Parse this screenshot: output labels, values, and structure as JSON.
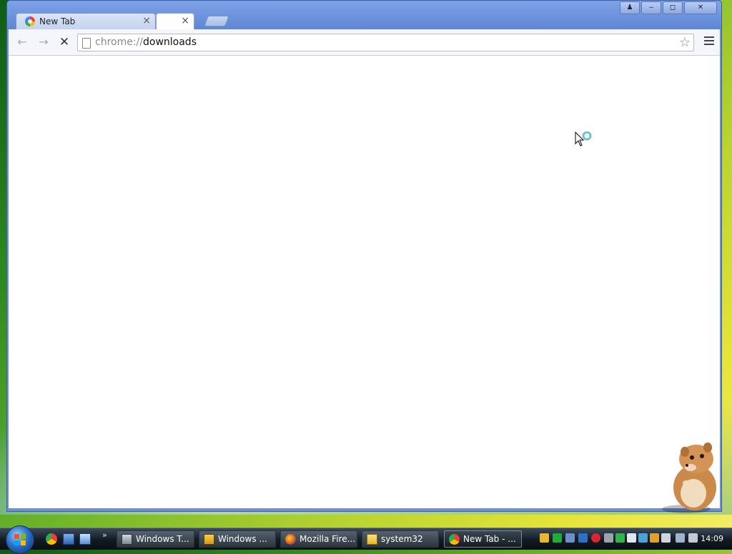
{
  "browser": {
    "tabs": [
      {
        "title": "New Tab",
        "active": false,
        "close": "×"
      },
      {
        "title": "",
        "active": true,
        "close": "×"
      }
    ],
    "window_controls": {
      "user": "♟",
      "minimize": "‒",
      "maximize": "◻",
      "close": "✕"
    },
    "nav": {
      "back": "←",
      "forward": "→",
      "stop": "✕"
    },
    "omnibox": {
      "scheme": "chrome://",
      "rest": "downloads"
    },
    "star": "☆"
  },
  "taskbar": {
    "quick_launch_more": "»",
    "tasks": [
      {
        "label": "Windows T...",
        "icon": "windows-task-manager-icon",
        "active": false
      },
      {
        "label": "Windows ...",
        "icon": "windows-media-icon",
        "active": false
      },
      {
        "label": "Mozilla Fire...",
        "icon": "firefox-icon",
        "active": false
      },
      {
        "label": "system32",
        "icon": "folder-icon",
        "active": false
      },
      {
        "label": "New Tab - ...",
        "icon": "chrome-icon",
        "active": true
      }
    ],
    "clock": "14:09"
  },
  "colors": {
    "title_bar": "#6c8fd6",
    "taskbar": "#121a22",
    "content_bg": "#ffffff"
  }
}
